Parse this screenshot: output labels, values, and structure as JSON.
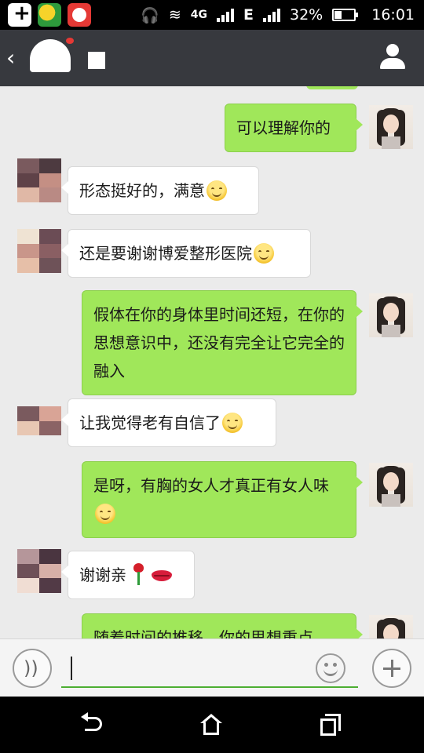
{
  "status_bar": {
    "network_type": "4G",
    "data_type": "E",
    "battery_percent": "32%",
    "time": "16:01"
  },
  "header": {
    "back_icon": "chevron-left-icon",
    "profile_icon": "person-icon"
  },
  "messages": [
    {
      "side": "out",
      "text": "可以理解你的",
      "emoji": null
    },
    {
      "side": "in",
      "text": "形态挺好的，满意",
      "emoji": "smile"
    },
    {
      "side": "in",
      "text": "还是要谢谢博爱整形医院",
      "emoji": "smile"
    },
    {
      "side": "out",
      "text": "假体在你的身体里时间还短，在你的思想意识中，还没有完全让它完全的融入",
      "emoji": null
    },
    {
      "side": "in",
      "text": "让我觉得老有自信了",
      "emoji": "smile"
    },
    {
      "side": "out",
      "text": "是呀，有胸的女人才真正有女人味",
      "emoji": "smile"
    },
    {
      "side": "in",
      "text": "谢谢亲",
      "emoji": "rose+lips"
    },
    {
      "side": "out",
      "text": "随着时间的推移，你的思想重点",
      "emoji": null
    }
  ],
  "input_bar": {
    "voice_icon": "voice-icon",
    "input_value": "",
    "emoji_icon": "smiley-icon",
    "plus_icon": "plus-icon"
  },
  "nav_bar": {
    "back_icon": "back-icon",
    "home_icon": "home-icon",
    "recent_icon": "recent-apps-icon"
  },
  "colors": {
    "outgoing_bubble": "#a0e75a",
    "incoming_bubble": "#ffffff",
    "chat_background": "#ebebeb",
    "header_background": "#37393e"
  }
}
